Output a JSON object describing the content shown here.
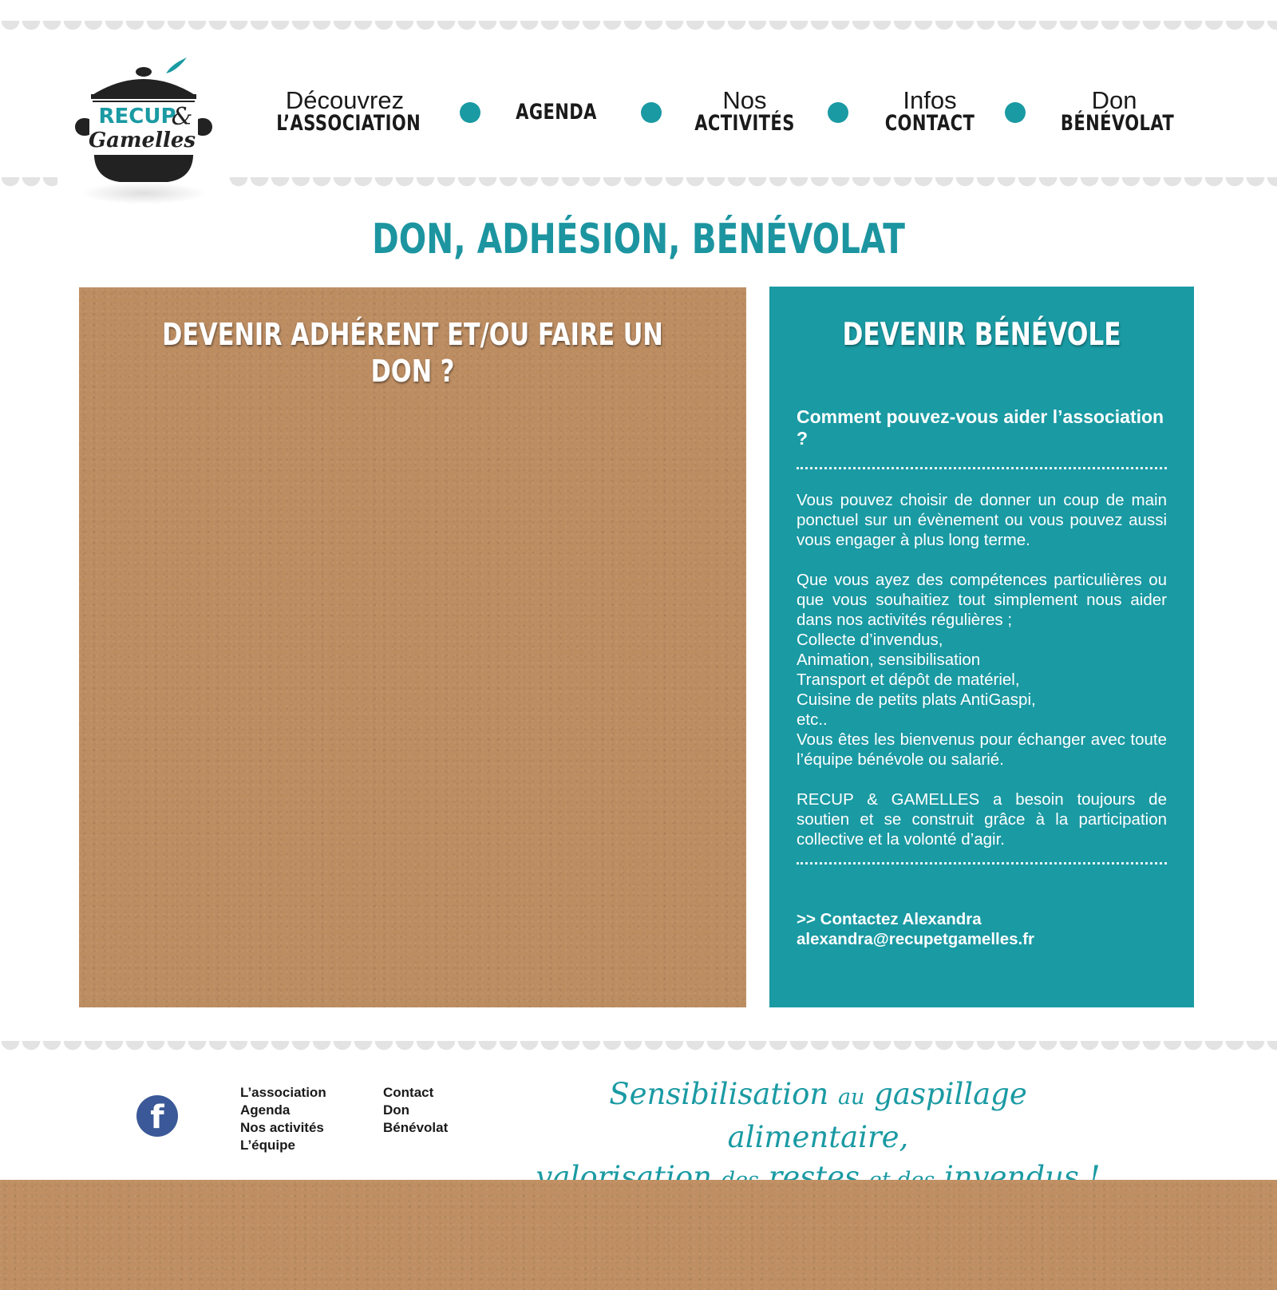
{
  "logo": {
    "line1": "RECUP",
    "ampersand": "&",
    "line2": "Gamelles"
  },
  "nav": [
    {
      "line1": "Découvrez",
      "line2": "L’ASSOCIATION"
    },
    {
      "line1": "",
      "line2": "AGENDA"
    },
    {
      "line1": "Nos",
      "line2": "ACTIVITÉS"
    },
    {
      "line1": "Infos",
      "line2": "CONTACT"
    },
    {
      "line1": "Don",
      "line2": "BÉNÉVOLAT"
    }
  ],
  "page_title": "DON, ADHÉSION, BÉNÉVOLAT",
  "left_panel": {
    "title": "DEVENIR ADHÉRENT ET/OU FAIRE UN DON ?"
  },
  "right_panel": {
    "title": "DEVENIR BÉNÉVOLE",
    "question": "Comment pouvez-vous aider l’association ?",
    "para1": "Vous pouvez choisir de donner un coup de main ponctuel sur un évènement ou vous pouvez aussi vous engager à plus long terme.",
    "para2_lines": [
      "Que vous ayez des compétences particulières ou que vous souhaitiez tout simplement nous aider dans nos activités régulières ;",
      "Collecte d’invendus,",
      "Animation, sensibilisation",
      "Transport et dépôt de matériel,",
      "Cuisine de petits plats AntiGaspi,",
      "etc..",
      "Vous êtes les bienvenus pour échanger avec toute l’équipe bénévole ou salarié."
    ],
    "para3": "RECUP & GAMELLES a besoin toujours de soutien et se construit grâce à la participation collective et la volonté d’agir.",
    "contact_label": ">> Contactez Alexandra",
    "contact_email": "alexandra@recupetgamelles.fr"
  },
  "footer": {
    "facebook_glyph": "f",
    "col1": [
      "L’association",
      "Agenda",
      "Nos activités",
      "L’équipe"
    ],
    "col2": [
      "Contact",
      "Don",
      "Bénévolat"
    ],
    "tagline": {
      "w1": "Sensibilisation",
      "w2": "au",
      "w3": "gaspillage alimentaire,",
      "w4": "valorisation",
      "w5": "des",
      "w6": "restes",
      "w7": "et des",
      "w8": "invendus !"
    }
  },
  "colors": {
    "teal": "#1a9aa3",
    "kraft": "#bd8d62",
    "facebook": "#3b5998",
    "scallop": "#e3e3e3"
  }
}
